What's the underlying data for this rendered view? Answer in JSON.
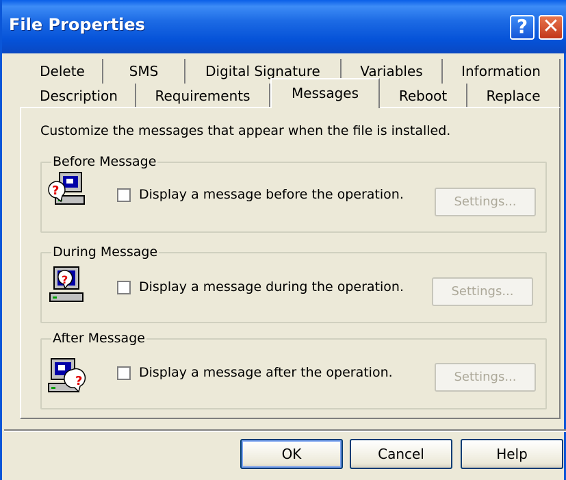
{
  "window": {
    "title": "File Properties"
  },
  "titlebar_buttons": {
    "help": "?",
    "close": "✕"
  },
  "tabs_row1": [
    "Delete",
    "SMS",
    "Digital Signature",
    "Variables",
    "Information"
  ],
  "tabs_row2": [
    "Description",
    "Requirements",
    "Messages",
    "Reboot",
    "Replace"
  ],
  "active_tab": "Messages",
  "intro": "Customize the messages that appear when the file is installed.",
  "groups": [
    {
      "title": "Before Message",
      "checkbox_label": "Display a message before the operation.",
      "checked": false,
      "settings_label": "Settings..."
    },
    {
      "title": "During Message",
      "checkbox_label": "Display a message during the operation.",
      "checked": false,
      "settings_label": "Settings..."
    },
    {
      "title": "After Message",
      "checkbox_label": "Display a message after the operation.",
      "checked": false,
      "settings_label": "Settings..."
    }
  ],
  "buttons": {
    "ok": "OK",
    "cancel": "Cancel",
    "help": "Help"
  },
  "colors": {
    "face": "#ece9d8",
    "titlebar": "#0552d8",
    "disabled_text": "#aca899"
  }
}
